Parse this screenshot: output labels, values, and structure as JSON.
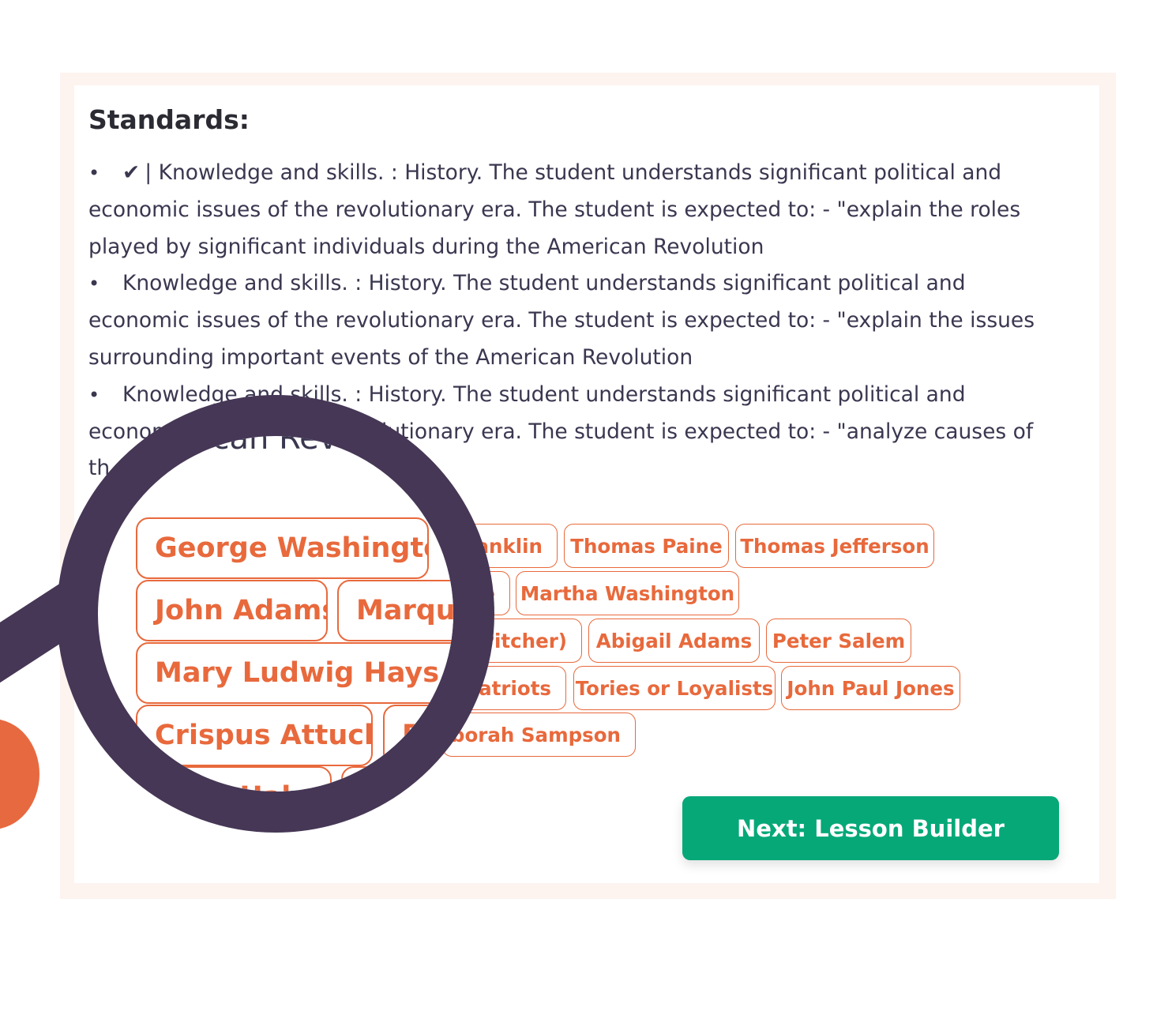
{
  "standards": {
    "heading": "Standards:",
    "check_mark": "✔",
    "items": [
      {
        "text": "| Knowledge and skills. : History. The student understands significant political and economic issues of the revolutionary era. The student is expected to: - \"explain the roles played by significant individuals during the American Revolution"
      },
      {
        "text": "Knowledge and skills. : History. The student understands significant political and economic issues of the revolutionary era. The student is expected to: - \"explain the issues surrounding important events of the American Revolution"
      },
      {
        "text": "Knowledge and skills. : History. The student understands significant political and economic issues of the revolutionary era. The student is expected to: - \"analyze causes of th"
      }
    ]
  },
  "tags": {
    "visible": [
      "anklin",
      "Thomas Paine",
      "Thomas Jefferson",
      "e",
      "Martha Washington",
      "Pitcher)",
      "Abigail Adams",
      "Peter Salem",
      "Patriots",
      "Tories or Loyalists",
      "John Paul Jones",
      "eborah Sampson"
    ]
  },
  "magnifier": {
    "lens_text": "American Revolution",
    "tags": [
      "George Washington",
      "John Adams",
      "Marquis",
      "Mary Ludwig Hays McC",
      "Crispus Attucks",
      "P",
      "n Hale"
    ]
  },
  "footer": {
    "next_label": "Next: Lesson Builder"
  },
  "colors": {
    "accent": "#e8693c",
    "primary_button": "#06a878",
    "dark": "#463756"
  }
}
